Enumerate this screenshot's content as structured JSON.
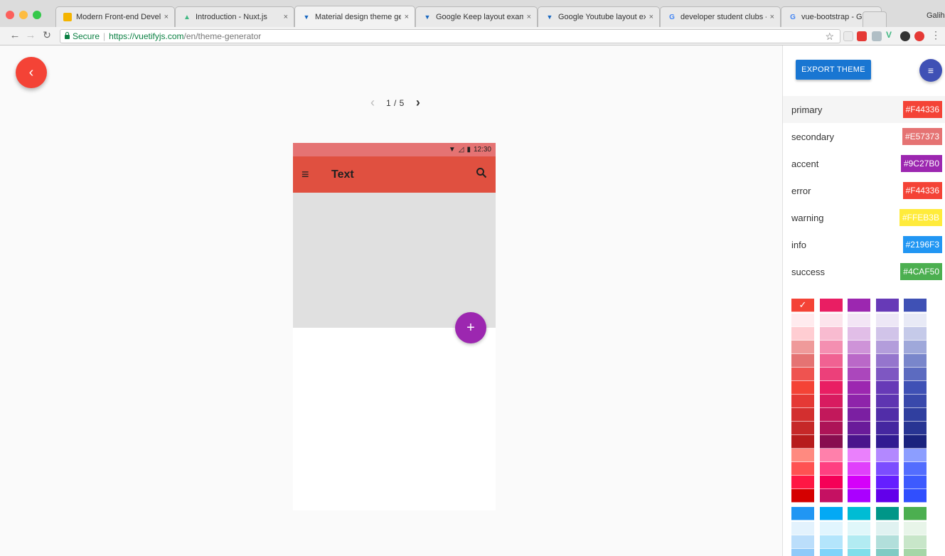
{
  "browser": {
    "tabs": [
      {
        "title": "Modern Front-end Developm",
        "favicon": "slides-icon",
        "color": "#f4b400"
      },
      {
        "title": "Introduction - Nuxt.js",
        "favicon": "nuxt-icon",
        "color": "#41b883"
      },
      {
        "title": "Material design theme gener",
        "favicon": "vuetify-icon",
        "color": "#1867c0",
        "active": true
      },
      {
        "title": "Google Keep layout example",
        "favicon": "vuetify-icon",
        "color": "#1867c0"
      },
      {
        "title": "Google Youtube layout exam",
        "favicon": "vuetify-icon",
        "color": "#1867c0"
      },
      {
        "title": "developer student clubs - G",
        "favicon": "google-icon",
        "color": "#4285f4"
      },
      {
        "title": "vue-bootstrap - Google Sea",
        "favicon": "google-icon",
        "color": "#4285f4"
      }
    ],
    "tab_close": "×",
    "profile": "Galih",
    "secure_label": "Secure",
    "url_scheme_host": "https://vuetifyjs.com",
    "url_path": "/en/theme-generator"
  },
  "page": {
    "back_icon": "‹",
    "pager": {
      "current": "1 / 5"
    },
    "phone": {
      "time": "12:30",
      "appbar_title": "Text",
      "fab_icon": "+"
    }
  },
  "sidebar": {
    "export_label": "EXPORT THEME",
    "menu_icon": "≡",
    "theme": [
      {
        "name": "primary",
        "value": "#F44336"
      },
      {
        "name": "secondary",
        "value": "#E57373"
      },
      {
        "name": "accent",
        "value": "#9C27B0"
      },
      {
        "name": "error",
        "value": "#F44336"
      },
      {
        "name": "warning",
        "value": "#FFEB3B"
      },
      {
        "name": "info",
        "value": "#2196F3"
      },
      {
        "name": "success",
        "value": "#4CAF50"
      }
    ],
    "palette_check": "✓",
    "palette_groups": [
      [
        [
          "#f44336",
          "#ffebee",
          "#ffcdd2",
          "#ef9a9a",
          "#e57373",
          "#ef5350",
          "#f44336",
          "#e53935",
          "#d32f2f",
          "#c62828",
          "#b71c1c",
          "#ff8a80",
          "#ff5252",
          "#ff1744",
          "#d50000"
        ],
        [
          "#e91e63",
          "#fce4ec",
          "#f8bbd0",
          "#f48fb1",
          "#f06292",
          "#ec407a",
          "#e91e63",
          "#d81b60",
          "#c2185b",
          "#ad1457",
          "#880e4f",
          "#ff80ab",
          "#ff4081",
          "#f50057",
          "#c51162"
        ],
        [
          "#9c27b0",
          "#f3e5f5",
          "#e1bee7",
          "#ce93d8",
          "#ba68c8",
          "#ab47bc",
          "#9c27b0",
          "#8e24aa",
          "#7b1fa2",
          "#6a1b9a",
          "#4a148c",
          "#ea80fc",
          "#e040fb",
          "#d500f9",
          "#aa00ff"
        ],
        [
          "#673ab7",
          "#ede7f6",
          "#d1c4e9",
          "#b39ddb",
          "#9575cd",
          "#7e57c2",
          "#673ab7",
          "#5e35b1",
          "#512da8",
          "#4527a0",
          "#311b92",
          "#b388ff",
          "#7c4dff",
          "#651fff",
          "#6200ea"
        ],
        [
          "#3f51b5",
          "#e8eaf6",
          "#c5cae9",
          "#9fa8da",
          "#7986cb",
          "#5c6bc0",
          "#3f51b5",
          "#3949ab",
          "#303f9f",
          "#283593",
          "#1a237e",
          "#8c9eff",
          "#536dfe",
          "#3d5afe",
          "#304ffe"
        ]
      ],
      [
        [
          "#2196f3",
          "#e3f2fd",
          "#bbdefb",
          "#90caf9"
        ],
        [
          "#03a9f4",
          "#e1f5fe",
          "#b3e5fc",
          "#81d4fa"
        ],
        [
          "#00bcd4",
          "#e0f7fa",
          "#b2ebf2",
          "#80deea"
        ],
        [
          "#009688",
          "#e0f2f1",
          "#b2dfdb",
          "#80cbc4"
        ],
        [
          "#4caf50",
          "#e8f5e9",
          "#c8e6c9",
          "#a5d6a7"
        ]
      ]
    ]
  }
}
